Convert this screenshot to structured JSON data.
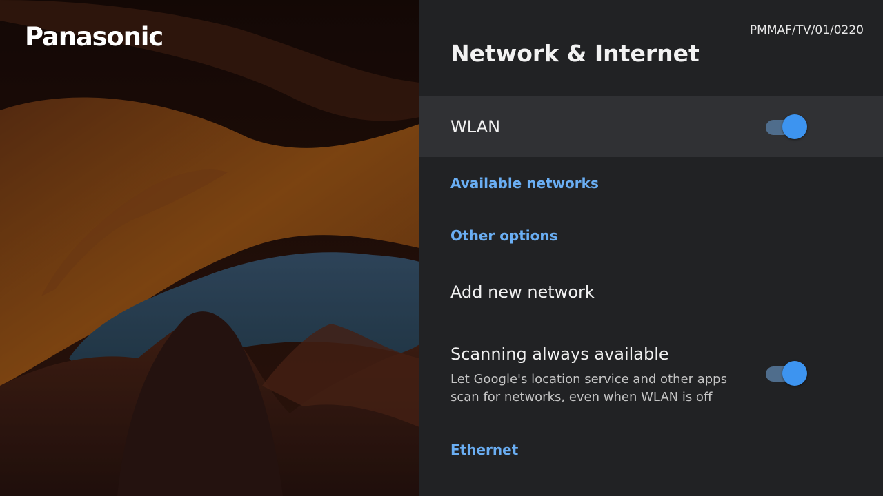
{
  "brand": {
    "logo_text": "Panasonic"
  },
  "model_id": "PMMAF/TV/01/0220",
  "title": "Network & Internet",
  "wlan": {
    "label": "WLAN",
    "enabled": true
  },
  "sections": {
    "available_networks": "Available networks",
    "other_options": "Other options",
    "ethernet": "Ethernet"
  },
  "add_network": {
    "label": "Add new network"
  },
  "scanning": {
    "label": "Scanning always available",
    "description": "Let Google's location service and other apps scan for networks, even when WLAN is off",
    "enabled": true
  },
  "colors": {
    "accent": "#6aaef3",
    "toggle_on": "#3d94f0",
    "panel_bg": "#212224",
    "focused_row_bg": "#303134"
  }
}
